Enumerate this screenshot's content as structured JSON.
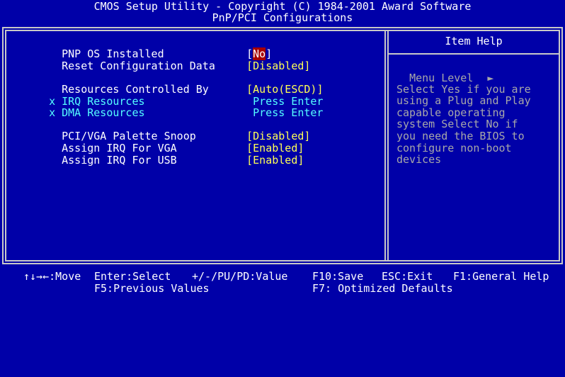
{
  "title": {
    "line1": "CMOS Setup Utility - Copyright (C) 1984-2001 Award Software",
    "line2": "PnP/PCI Configurations"
  },
  "settings": [
    {
      "label": "PNP OS Installed",
      "value": "No",
      "open": "[",
      "close": "]",
      "selected": true,
      "disabled": false
    },
    {
      "label": "Reset Configuration Data",
      "value": "Disabled",
      "open": "[",
      "close": "]",
      "selected": false,
      "disabled": false
    },
    {
      "label": "Resources Controlled By",
      "value": "Auto(ESCD)",
      "open": "[",
      "close": "]",
      "selected": false,
      "disabled": false
    },
    {
      "prefix": "x",
      "label": "IRQ Resources",
      "value": "Press Enter",
      "disabled": true
    },
    {
      "prefix": "x",
      "label": "DMA Resources",
      "value": "Press Enter",
      "disabled": true
    },
    {
      "label": "PCI/VGA Palette Snoop",
      "value": "Disabled",
      "open": "[",
      "close": "]",
      "selected": false,
      "disabled": false
    },
    {
      "label": "Assign IRQ For VGA",
      "value": "Enabled",
      "open": "[",
      "close": "]",
      "selected": false,
      "disabled": false
    },
    {
      "label": "Assign IRQ For USB",
      "value": "Enabled",
      "open": "[",
      "close": "]",
      "selected": false,
      "disabled": false
    }
  ],
  "help": {
    "title": "Item Help",
    "menu_level": "Menu Level",
    "menu_level_arrow": "►",
    "lines": [
      "Select Yes if you are",
      "using a Plug and Play",
      "capable operating",
      "system Select No if",
      "you need the BIOS to",
      "configure non-boot",
      "devices"
    ]
  },
  "footer": {
    "move": "↑↓→←:Move",
    "select": "Enter:Select",
    "value": "+/-/PU/PD:Value",
    "save": "F10:Save",
    "exit": "ESC:Exit",
    "help": "F1:General Help",
    "previous": "F5:Previous Values",
    "defaults": "F7: Optimized Defaults"
  },
  "colors": {
    "background": "#0000a8",
    "value": "#ffff55",
    "disabled": "#55ffff",
    "selected_bg": "#a80000",
    "help_text": "#a8a8a8"
  }
}
